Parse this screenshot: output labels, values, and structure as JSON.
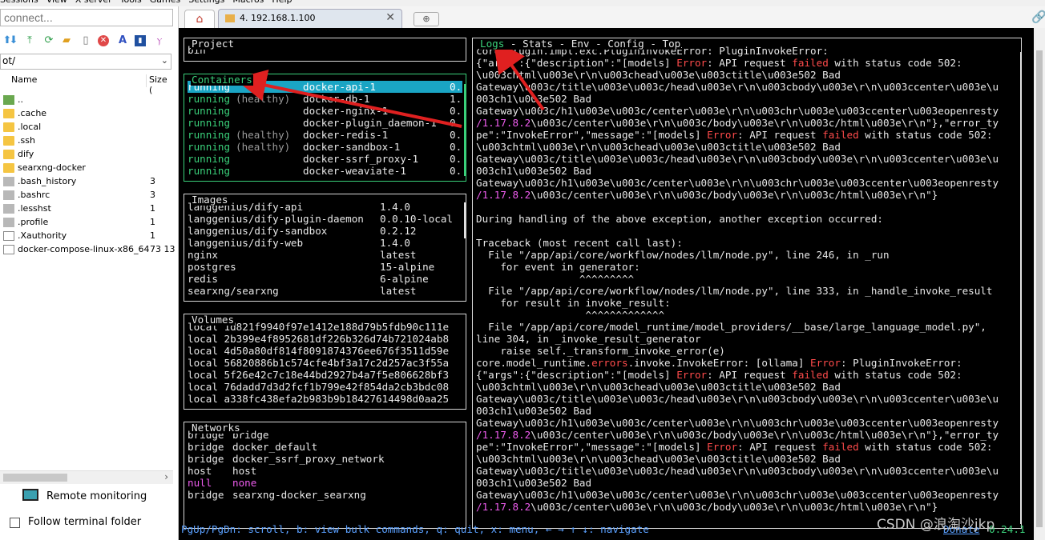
{
  "menubar": {
    "items": [
      "Sessions",
      "View",
      "X server",
      "Tools",
      "Games",
      "Settings",
      "Macros",
      "Help"
    ]
  },
  "sidebar": {
    "quick_connect_placeholder": "connect...",
    "path_value": "ot/",
    "col_name": "Name",
    "col_size": "Size (",
    "files": [
      {
        "name": "..",
        "size": "",
        "kind": "up"
      },
      {
        "name": ".cache",
        "size": "",
        "kind": "folder"
      },
      {
        "name": ".local",
        "size": "",
        "kind": "folder"
      },
      {
        "name": ".ssh",
        "size": "",
        "kind": "folder"
      },
      {
        "name": "dify",
        "size": "",
        "kind": "folder"
      },
      {
        "name": "searxng-docker",
        "size": "",
        "kind": "folder"
      },
      {
        "name": ".bash_history",
        "size": "3",
        "kind": "file"
      },
      {
        "name": ".bashrc",
        "size": "3",
        "kind": "file"
      },
      {
        "name": ".lesshst",
        "size": "1",
        "kind": "file"
      },
      {
        "name": ".profile",
        "size": "1",
        "kind": "file"
      },
      {
        "name": ".Xauthority",
        "size": "1",
        "kind": "fileb"
      },
      {
        "name": "docker-compose-linux-x86_64",
        "size": "73 13",
        "kind": "fileb"
      }
    ],
    "remote_monitoring": "Remote monitoring",
    "follow_terminal": "Follow terminal folder",
    "follow_checked": false
  },
  "tabs": {
    "home_icon": "home-icon",
    "active_tab": "4. 192.168.1.100",
    "close": "✕"
  },
  "panels": {
    "project": {
      "title": "Project",
      "value": "bin"
    },
    "containers": {
      "title": "Containers",
      "rows": [
        {
          "status": "running",
          "health": "",
          "name": "docker-api-1",
          "cpu": "0.",
          "selected": true
        },
        {
          "status": "running",
          "health": "(healthy)",
          "name": "docker-db-1",
          "cpu": "1.",
          "selected": false
        },
        {
          "status": "running",
          "health": "",
          "name": "docker-nginx-1",
          "cpu": "0.",
          "selected": false
        },
        {
          "status": "running",
          "health": "",
          "name": "docker-plugin_daemon-1",
          "cpu": "0.",
          "selected": false
        },
        {
          "status": "running",
          "health": "(healthy)",
          "name": "docker-redis-1",
          "cpu": "0.",
          "selected": false
        },
        {
          "status": "running",
          "health": "(healthy)",
          "name": "docker-sandbox-1",
          "cpu": "0.",
          "selected": false
        },
        {
          "status": "running",
          "health": "",
          "name": "docker-ssrf_proxy-1",
          "cpu": "0.",
          "selected": false
        },
        {
          "status": "running",
          "health": "",
          "name": "docker-weaviate-1",
          "cpu": "0.",
          "selected": false
        }
      ]
    },
    "images": {
      "title": "Images",
      "rows": [
        {
          "name": "langgenius/dify-api",
          "tag": "1.4.0"
        },
        {
          "name": "langgenius/dify-plugin-daemon",
          "tag": "0.0.10-local"
        },
        {
          "name": "langgenius/dify-sandbox",
          "tag": "0.2.12"
        },
        {
          "name": "langgenius/dify-web",
          "tag": "1.4.0"
        },
        {
          "name": "nginx",
          "tag": "latest"
        },
        {
          "name": "postgres",
          "tag": "15-alpine"
        },
        {
          "name": "redis",
          "tag": "6-alpine"
        },
        {
          "name": "searxng/searxng",
          "tag": "latest"
        }
      ]
    },
    "volumes": {
      "title": "Volumes",
      "rows": [
        "local 1d821f9940f97e1412e188d79b5fdb90c111e",
        "local 2b399e4f8952681df226b326d74b721024ab8",
        "local 4d50a80df814f8091874376ee676f3511d59e",
        "local 56820886b1c574cfe4bf3a17c2d257ac3f55a",
        "local 5f26e42c7c18e44bd2927b4a7f5e806628bf3",
        "local 76dadd7d3d2fcf1b799e42f854da2cb3bdc08",
        "local a338fc438efa2b983b9b18427614498d0aa25"
      ]
    },
    "networks": {
      "title": "Networks",
      "rows": [
        {
          "driver": "bridge",
          "name": "bridge",
          "null": false
        },
        {
          "driver": "bridge",
          "name": "docker_default",
          "null": false
        },
        {
          "driver": "bridge",
          "name": "docker_ssrf_proxy_network",
          "null": false
        },
        {
          "driver": "host",
          "name": "host",
          "null": false
        },
        {
          "driver": "null",
          "name": "none",
          "null": true
        },
        {
          "driver": "bridge",
          "name": "searxng-docker_searxng",
          "null": false
        }
      ]
    }
  },
  "logs": {
    "tabs": [
      "Logs",
      "Stats",
      "Env",
      "Config",
      "Top"
    ],
    "active_tab": "Logs",
    "lines": [
      [
        [
          "core.plugin.impl.exc.PluginInvokeError: PluginInvokeError:",
          ""
        ]
      ],
      [
        [
          "{\"args\":{\"description\":\"[models] ",
          ""
        ],
        [
          "Error",
          "r"
        ],
        [
          ": API request ",
          ""
        ],
        [
          "failed",
          "r"
        ],
        [
          " with status code 502:",
          ""
        ]
      ],
      [
        [
          "\\u003chtml\\u003e\\r\\n\\u003chead\\u003e\\u003ctitle\\u003e502 Bad",
          ""
        ]
      ],
      [
        [
          "Gateway\\u003c/title\\u003e\\u003c/head\\u003e\\r\\n\\u003cbody\\u003e\\r\\n\\u003ccenter\\u003e\\u",
          ""
        ]
      ],
      [
        [
          "003ch1\\u003e502 Bad",
          ""
        ]
      ],
      [
        [
          "Gateway\\u003c/h1\\u003e\\u003c/center\\u003e\\r\\n\\u003chr\\u003e\\u003ccenter\\u003eopenresty",
          ""
        ]
      ],
      [
        [
          "/1.17.8.2",
          "m"
        ],
        [
          "\\u003c/center\\u003e\\r\\n\\u003c/body\\u003e\\r\\n\\u003c/html\\u003e\\r\\n\"},\"error_ty",
          ""
        ]
      ],
      [
        [
          "pe\":\"InvokeError\",\"message\":\"[models] ",
          ""
        ],
        [
          "Error",
          "r"
        ],
        [
          ": API request ",
          ""
        ],
        [
          "failed",
          "r"
        ],
        [
          " with status code 502:",
          ""
        ]
      ],
      [
        [
          "\\u003chtml\\u003e\\r\\n\\u003chead\\u003e\\u003ctitle\\u003e502 Bad",
          ""
        ]
      ],
      [
        [
          "Gateway\\u003c/title\\u003e\\u003c/head\\u003e\\r\\n\\u003cbody\\u003e\\r\\n\\u003ccenter\\u003e\\u",
          ""
        ]
      ],
      [
        [
          "003ch1\\u003e502 Bad",
          ""
        ]
      ],
      [
        [
          "Gateway\\u003c/h1\\u003e\\u003c/center\\u003e\\r\\n\\u003chr\\u003e\\u003ccenter\\u003eopenresty",
          ""
        ]
      ],
      [
        [
          "/1.17.8.2",
          "m"
        ],
        [
          "\\u003c/center\\u003e\\r\\n\\u003c/body\\u003e\\r\\n\\u003c/html\\u003e\\r\\n\"}",
          ""
        ]
      ],
      [
        [
          "",
          ""
        ]
      ],
      [
        [
          "During handling of the above exception, another exception occurred:",
          ""
        ]
      ],
      [
        [
          "",
          ""
        ]
      ],
      [
        [
          "Traceback (most recent call last):",
          ""
        ]
      ],
      [
        [
          "  File \"/app/api/core/workflow/nodes/llm/node.py\", line 246, in _run",
          ""
        ]
      ],
      [
        [
          "    for event in generator:",
          ""
        ]
      ],
      [
        [
          "                 ^^^^^^^^^",
          ""
        ]
      ],
      [
        [
          "  File \"/app/api/core/workflow/nodes/llm/node.py\", line 333, in _handle_invoke_result",
          ""
        ]
      ],
      [
        [
          "    for result in invoke_result:",
          ""
        ]
      ],
      [
        [
          "                  ^^^^^^^^^^^^^",
          ""
        ]
      ],
      [
        [
          "  File \"/app/api/core/model_runtime/model_providers/__base/large_language_model.py\",",
          ""
        ]
      ],
      [
        [
          "line 304, in _invoke_result_generator",
          ""
        ]
      ],
      [
        [
          "    raise self._transform_invoke_error(e)",
          ""
        ]
      ],
      [
        [
          "core.model_runtime.",
          ""
        ],
        [
          "errors",
          "r"
        ],
        [
          ".invoke.InvokeError: [ollama] ",
          ""
        ],
        [
          "Error",
          "r"
        ],
        [
          ": PluginInvokeError:",
          ""
        ]
      ],
      [
        [
          "{\"args\":{\"description\":\"[models] ",
          ""
        ],
        [
          "Error",
          "r"
        ],
        [
          ": API request ",
          ""
        ],
        [
          "failed",
          "r"
        ],
        [
          " with status code 502:",
          ""
        ]
      ],
      [
        [
          "\\u003chtml\\u003e\\r\\n\\u003chead\\u003e\\u003ctitle\\u003e502 Bad",
          ""
        ]
      ],
      [
        [
          "Gateway\\u003c/title\\u003e\\u003c/head\\u003e\\r\\n\\u003cbody\\u003e\\r\\n\\u003ccenter\\u003e\\u",
          ""
        ]
      ],
      [
        [
          "003ch1\\u003e502 Bad",
          ""
        ]
      ],
      [
        [
          "Gateway\\u003c/h1\\u003e\\u003c/center\\u003e\\r\\n\\u003chr\\u003e\\u003ccenter\\u003eopenresty",
          ""
        ]
      ],
      [
        [
          "/1.17.8.2",
          "m"
        ],
        [
          "\\u003c/center\\u003e\\r\\n\\u003c/body\\u003e\\r\\n\\u003c/html\\u003e\\r\\n\"},\"error_ty",
          ""
        ]
      ],
      [
        [
          "pe\":\"InvokeError\",\"message\":\"[models] ",
          ""
        ],
        [
          "Error",
          "r"
        ],
        [
          ": API request ",
          ""
        ],
        [
          "failed",
          "r"
        ],
        [
          " with status code 502:",
          ""
        ]
      ],
      [
        [
          "\\u003chtml\\u003e\\r\\n\\u003chead\\u003e\\u003ctitle\\u003e502 Bad",
          ""
        ]
      ],
      [
        [
          "Gateway\\u003c/title\\u003e\\u003c/head\\u003e\\r\\n\\u003cbody\\u003e\\r\\n\\u003ccenter\\u003e\\u",
          ""
        ]
      ],
      [
        [
          "003ch1\\u003e502 Bad",
          ""
        ]
      ],
      [
        [
          "Gateway\\u003c/h1\\u003e\\u003c/center\\u003e\\r\\n\\u003chr\\u003e\\u003ccenter\\u003eopenresty",
          ""
        ]
      ],
      [
        [
          "/1.17.8.2",
          "m"
        ],
        [
          "\\u003c/center\\u003e\\r\\n\\u003c/body\\u003e\\r\\n\\u003c/html\\u003e\\r\\n\"}",
          ""
        ]
      ]
    ]
  },
  "statusbar": {
    "help": "PgUp/PgDn: scroll, b: view bulk commands, q: quit, x: menu, ← → ↑ ↓: navigate",
    "donate": "Donate",
    "version": "0.24.1"
  },
  "watermark": "CSDN @浪淘沙jkp",
  "colors": {
    "accent_green": "#3ad07a",
    "error_red": "#ff4b4b",
    "magenta": "#ee5cee",
    "status_blue": "#5aa0ff",
    "selection": "#1aa5c4",
    "arrow": "#e02020"
  }
}
